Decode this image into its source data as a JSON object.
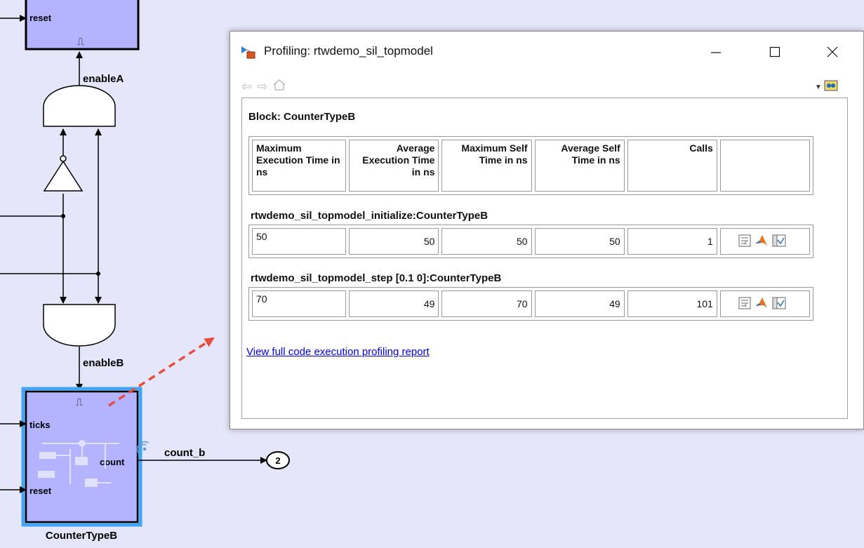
{
  "diagram": {
    "blocks": {
      "top_reset_port": "reset",
      "counter_b_name": "CounterTypeB",
      "counter_b_ticks_port": "ticks",
      "counter_b_count_port": "count",
      "counter_b_reset_port": "reset",
      "trigger_symbol": "⎍"
    },
    "signals": {
      "enable_a": "enableA",
      "enable_b": "enableB",
      "count_b": "count_b"
    },
    "outport_number": "2"
  },
  "profiling_window": {
    "title": "Profiling: rtwdemo_sil_topmodel",
    "block_label": "Block: CounterTypeB",
    "columns": [
      "Maximum Execution Time in ns",
      "Average Execution Time in ns",
      "Maximum Self Time in ns",
      "Average Self Time in ns",
      "Calls"
    ],
    "functions": [
      {
        "name": "rtwdemo_sil_topmodel_initialize:CounterTypeB",
        "max_exec": "50",
        "avg_exec": "50",
        "max_self": "50",
        "avg_self": "50",
        "calls": "1"
      },
      {
        "name": "rtwdemo_sil_topmodel_step [0.1 0]:CounterTypeB",
        "max_exec": "70",
        "avg_exec": "49",
        "max_self": "70",
        "avg_self": "49",
        "calls": "101"
      }
    ],
    "report_link": "View full code execution profiling report",
    "window_buttons": {
      "minimize": "—",
      "maximize": "☐",
      "close": "✕"
    },
    "nav": {
      "back": "⇦",
      "forward": "⇨"
    }
  },
  "colors": {
    "canvas_bg": "#e6e6fa",
    "block_fill": "#b3b3ff",
    "selection_blue": "#42a5f5",
    "callout_arrow": "#e74c3c",
    "link_blue": "#0000ee"
  }
}
